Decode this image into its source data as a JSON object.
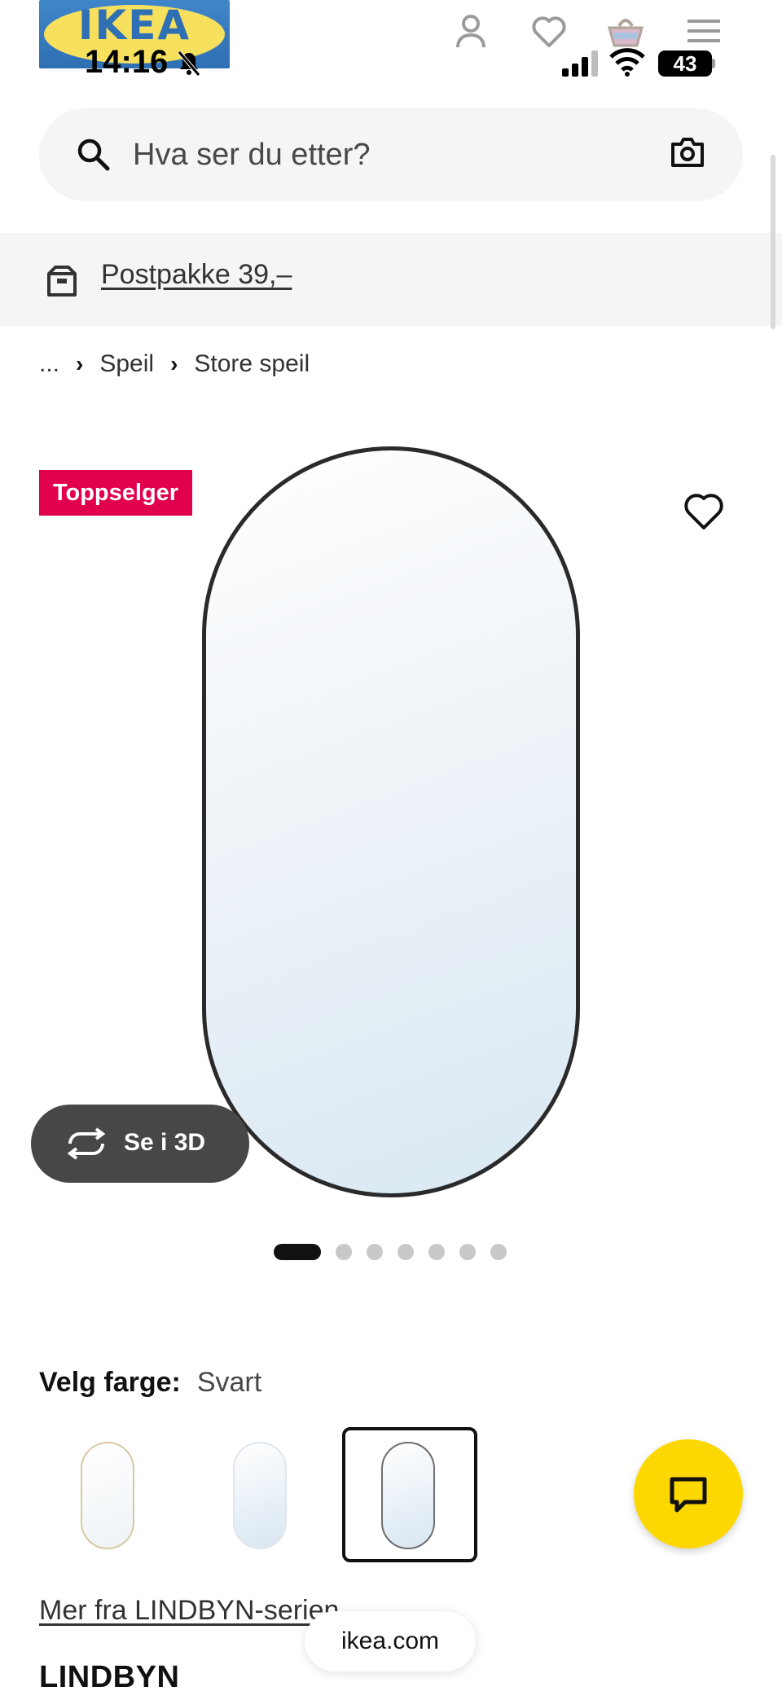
{
  "status_bar": {
    "time": "14:16",
    "battery": "43"
  },
  "header": {
    "logo_text": "IKEA",
    "icons": [
      "account-icon",
      "heart-icon",
      "cart-icon",
      "menu-icon"
    ]
  },
  "search": {
    "placeholder": "Hva ser du etter?"
  },
  "shipping_banner": {
    "label": "Postpakke 39,–"
  },
  "breadcrumb": {
    "items": [
      "...",
      "Speil",
      "Store speil"
    ]
  },
  "product_gallery": {
    "badge": "Toppselger",
    "view_3d_label": "Se i 3D",
    "image_count": 7,
    "active_index": 0
  },
  "color_selector": {
    "label": "Velg farge:",
    "selected": "Svart",
    "swatch_colors": [
      "#d8c9a2",
      "#c9d3df",
      "#6e6e6e"
    ],
    "selected_index": 2
  },
  "series_link": "Mer fra LINDBYN-serien",
  "url_pill": "ikea.com",
  "product": {
    "name": "LINDBYN"
  },
  "colors": {
    "badge": "#e0004d",
    "chat": "#fcd800",
    "band": "#f5f5f5"
  }
}
